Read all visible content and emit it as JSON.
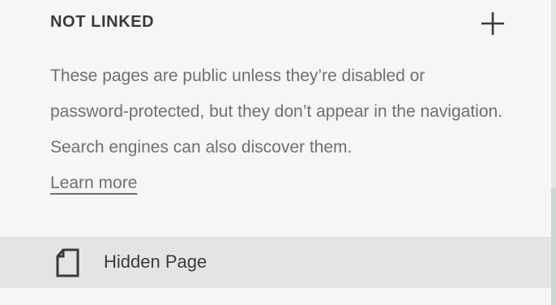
{
  "section": {
    "title": "NOT LINKED",
    "description": "These pages are public unless they’re disabled or password-protected, but they don’t appear in the navigation. Search engines can also discover them.",
    "learn_more": "Learn more"
  },
  "pages": [
    {
      "label": "Hidden Page",
      "icon": "page-icon"
    }
  ],
  "icons": {
    "add": "plus-icon"
  },
  "colors": {
    "background": "#f6f6f6",
    "row_background": "#e4e4e4",
    "text_primary": "#3a3a3a",
    "text_secondary": "#6f6f6f"
  }
}
